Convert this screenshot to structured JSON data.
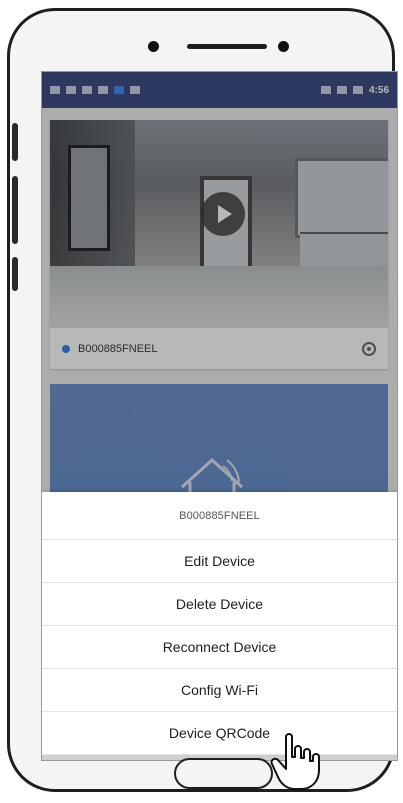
{
  "statusbar": {
    "left_icons": [
      "cast-icon",
      "signal-icon",
      "wifi-icon",
      "data-icon",
      "bluetooth-icon",
      "battery-saver-icon"
    ],
    "right_icons": [
      "alarm-icon",
      "nfc-icon",
      "sound-icon"
    ],
    "time": "4:56"
  },
  "device": {
    "name": "B000885FNEEL"
  },
  "action_sheet": {
    "title": "B000885FNEEL",
    "items": [
      {
        "label": "Edit Device"
      },
      {
        "label": "Delete Device"
      },
      {
        "label": "Reconnect Device"
      },
      {
        "label": "Config Wi-Fi"
      },
      {
        "label": "Device QRCode"
      }
    ]
  },
  "colors": {
    "statusbar_bg": "#3f4f86",
    "card_blue": "#6f93cc",
    "dot_blue": "#3a81e8",
    "overlay": "rgba(0,0,0,0.28)"
  }
}
